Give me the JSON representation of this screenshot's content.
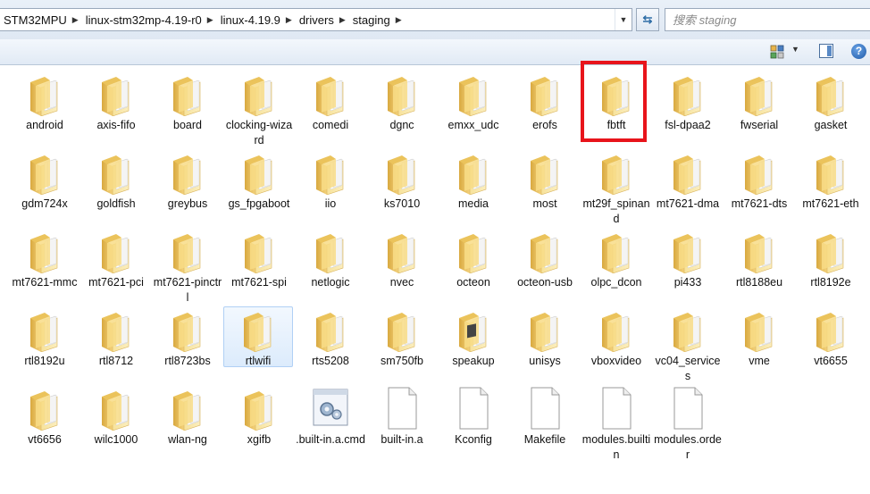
{
  "address": {
    "crumbs": [
      "STM32MPU",
      "linux-stm32mp-4.19-r0",
      "linux-4.19.9",
      "drivers",
      "staging"
    ]
  },
  "search": {
    "placeholder": "搜索 staging"
  },
  "items": [
    {
      "name": "android",
      "type": "folder"
    },
    {
      "name": "axis-fifo",
      "type": "folder"
    },
    {
      "name": "board",
      "type": "folder"
    },
    {
      "name": "clocking-wizard",
      "type": "folder"
    },
    {
      "name": "comedi",
      "type": "folder"
    },
    {
      "name": "dgnc",
      "type": "folder"
    },
    {
      "name": "emxx_udc",
      "type": "folder"
    },
    {
      "name": "erofs",
      "type": "folder"
    },
    {
      "name": "fbtft",
      "type": "folder",
      "highlighted": true
    },
    {
      "name": "fsl-dpaa2",
      "type": "folder"
    },
    {
      "name": "fwserial",
      "type": "folder"
    },
    {
      "name": "gasket",
      "type": "folder"
    },
    {
      "name": "gdm724x",
      "type": "folder"
    },
    {
      "name": "goldfish",
      "type": "folder"
    },
    {
      "name": "greybus",
      "type": "folder"
    },
    {
      "name": "gs_fpgaboot",
      "type": "folder"
    },
    {
      "name": "iio",
      "type": "folder"
    },
    {
      "name": "ks7010",
      "type": "folder"
    },
    {
      "name": "media",
      "type": "folder"
    },
    {
      "name": "most",
      "type": "folder"
    },
    {
      "name": "mt29f_spinand",
      "type": "folder"
    },
    {
      "name": "mt7621-dma",
      "type": "folder"
    },
    {
      "name": "mt7621-dts",
      "type": "folder"
    },
    {
      "name": "mt7621-eth",
      "type": "folder"
    },
    {
      "name": "mt7621-mmc",
      "type": "folder"
    },
    {
      "name": "mt7621-pci",
      "type": "folder"
    },
    {
      "name": "mt7621-pinctrl",
      "type": "folder"
    },
    {
      "name": "mt7621-spi",
      "type": "folder"
    },
    {
      "name": "netlogic",
      "type": "folder"
    },
    {
      "name": "nvec",
      "type": "folder"
    },
    {
      "name": "octeon",
      "type": "folder"
    },
    {
      "name": "octeon-usb",
      "type": "folder"
    },
    {
      "name": "olpc_dcon",
      "type": "folder"
    },
    {
      "name": "pi433",
      "type": "folder"
    },
    {
      "name": "rtl8188eu",
      "type": "folder"
    },
    {
      "name": "rtl8192e",
      "type": "folder"
    },
    {
      "name": "rtl8192u",
      "type": "folder"
    },
    {
      "name": "rtl8712",
      "type": "folder"
    },
    {
      "name": "rtl8723bs",
      "type": "folder"
    },
    {
      "name": "rtlwifi",
      "type": "folder",
      "selected": true
    },
    {
      "name": "rts5208",
      "type": "folder"
    },
    {
      "name": "sm750fb",
      "type": "folder"
    },
    {
      "name": "speakup",
      "type": "folder-doc"
    },
    {
      "name": "unisys",
      "type": "folder"
    },
    {
      "name": "vboxvideo",
      "type": "folder"
    },
    {
      "name": "vc04_services",
      "type": "folder"
    },
    {
      "name": "vme",
      "type": "folder"
    },
    {
      "name": "vt6655",
      "type": "folder"
    },
    {
      "name": "vt6656",
      "type": "folder"
    },
    {
      "name": "wilc1000",
      "type": "folder"
    },
    {
      "name": "wlan-ng",
      "type": "folder"
    },
    {
      "name": "xgifb",
      "type": "folder"
    },
    {
      "name": ".built-in.a.cmd",
      "type": "cmd-file"
    },
    {
      "name": "built-in.a",
      "type": "file"
    },
    {
      "name": "Kconfig",
      "type": "file"
    },
    {
      "name": "Makefile",
      "type": "file"
    },
    {
      "name": "modules.builtin",
      "type": "file"
    },
    {
      "name": "modules.order",
      "type": "file"
    }
  ]
}
